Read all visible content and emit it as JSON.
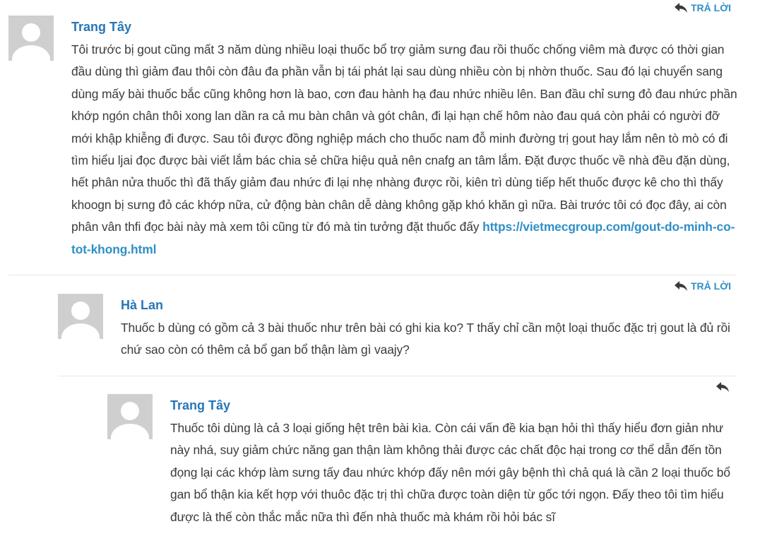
{
  "reply_label": "TRẢ LỜI",
  "comments": [
    {
      "author": "Trang Tây",
      "text_before_link": "Tôi trước bị gout cũng mất 3 năm dùng nhiều loại thuốc bổ trợ giảm sưng đau rồi thuốc chống viêm mà được có thời gian đầu dùng thì giảm đau thôi còn đâu đa phần vẫn bị tái phát lại sau dùng nhiều còn bị nhờn thuốc. Sau đó lại chuyển sang dùng mấy bài thuốc bắc cũng không hơn là bao, cơn đau hành hạ đau nhức nhiều lên. Ban đầu chỉ sưng đỏ đau nhức phần khớp ngón chân thôi xong lan dần ra cả mu bàn chân và gót chân, đi lại hạn chế hôm nào đau quá còn phải có người đỡ mới khập khiễng đi được. Sau tôi được đồng nghiệp mách cho thuốc nam đỗ minh đường trị gout hay lắm nên tò mò có đi tìm hiểu ljai đọc được bài viết lắm bác chia sẻ chữa hiệu quả nên cnafg an tâm lắm. Đặt được thuốc về nhà đều đặn dùng, hết phân nửa thuốc thì đã thấy giảm đau nhức đi lại nhẹ nhàng được rồi, kiên trì dùng tiếp hết thuốc được kê cho thì thấy khoogn bị sưng đỏ các khớp nữa, cử động bàn chân dễ dàng không gặp khó khăn gì nữa. Bài trước tôi có đọc đây, ai còn phân vân thfi đọc bài này mà xem tôi cũng từ đó mà tin tưởng đặt thuốc đấy ",
      "link": "https://vietmecgroup.com/gout-do-minh-co-tot-khong.html"
    },
    {
      "author": "Hà Lan",
      "text": "Thuốc b dùng có gồm cả 3 bài thuốc như trên bài có ghi kia ko? T thấy chỉ cần một loại thuốc đặc trị gout là đủ rồi chứ sao còn có thêm cả bổ gan bổ thận làm gì vaajy?"
    },
    {
      "author": "Trang Tây",
      "text": "Thuốc tôi dùng là cả 3 loại giống hệt trên bài kìa. Còn cái vấn đề kia bạn hỏi thì thấy hiểu đơn giản như này nhá, suy giảm chức năng gan thận làm không thải được các chất độc hại trong cơ thể dẫn đến tồn đọng lại các khớp làm sưng tấy đau nhức khớp đấy nên mới gây bệnh thì chả quá là cần 2 loại thuốc bổ gan bổ thận kia kết hợp với thuôc đặc trị thì chữa được toàn diện từ gốc tới ngọn. Đấy theo tôi tìm hiểu được là thế còn thắc mắc nữa thì đến nhà thuốc mà khám rồi hỏi bác sĩ"
    }
  ]
}
